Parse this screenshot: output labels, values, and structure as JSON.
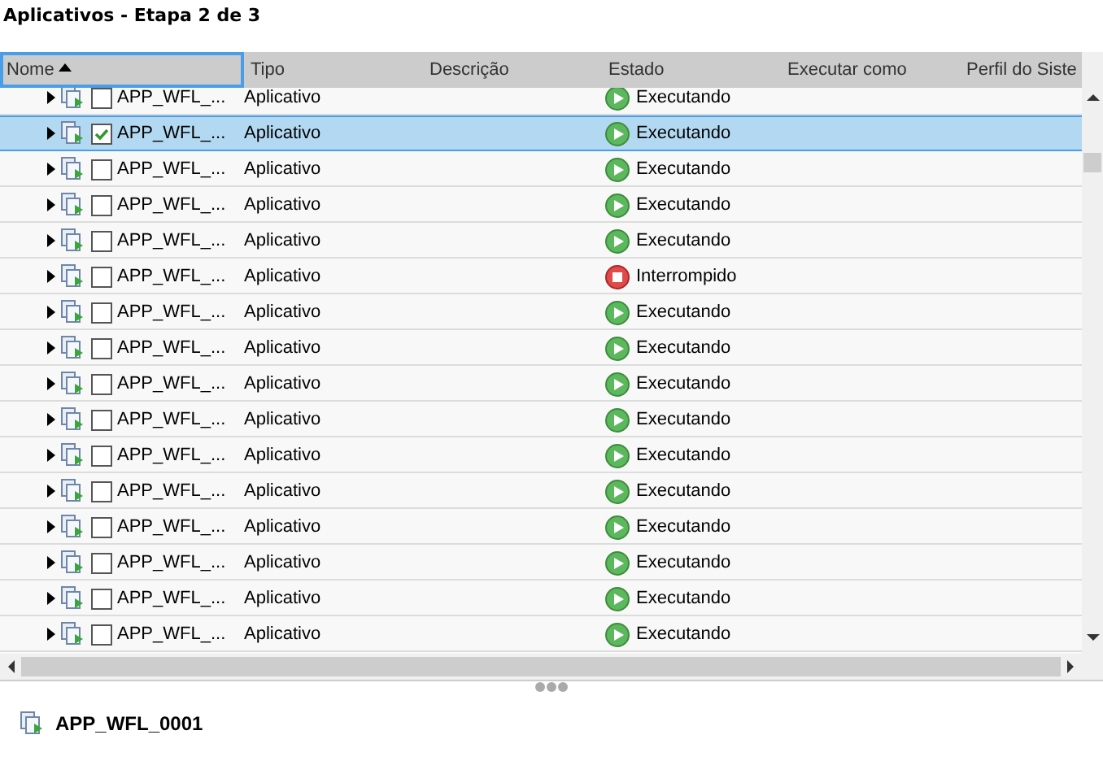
{
  "title": "Aplicativos - Etapa 2 de 3",
  "columns": [
    {
      "label": "Nome",
      "sorted": true,
      "focused": true
    },
    {
      "label": "Tipo",
      "sorted": false,
      "focused": false
    },
    {
      "label": "Descrição",
      "sorted": false,
      "focused": false
    },
    {
      "label": "Estado",
      "sorted": false,
      "focused": false
    },
    {
      "label": "Executar como",
      "sorted": false,
      "focused": false
    },
    {
      "label": "Perfil do Siste",
      "sorted": false,
      "focused": false
    }
  ],
  "rows": [
    {
      "name": "APP_WFL_...",
      "type": "Aplicativo",
      "status": "Executando",
      "kind": "running",
      "checked": false,
      "selected": false
    },
    {
      "name": "APP_WFL_...",
      "type": "Aplicativo",
      "status": "Executando",
      "kind": "running",
      "checked": true,
      "selected": true
    },
    {
      "name": "APP_WFL_...",
      "type": "Aplicativo",
      "status": "Executando",
      "kind": "running",
      "checked": false,
      "selected": false
    },
    {
      "name": "APP_WFL_...",
      "type": "Aplicativo",
      "status": "Executando",
      "kind": "running",
      "checked": false,
      "selected": false
    },
    {
      "name": "APP_WFL_...",
      "type": "Aplicativo",
      "status": "Executando",
      "kind": "running",
      "checked": false,
      "selected": false
    },
    {
      "name": "APP_WFL_...",
      "type": "Aplicativo",
      "status": "Interrompido",
      "kind": "stopped",
      "checked": false,
      "selected": false
    },
    {
      "name": "APP_WFL_...",
      "type": "Aplicativo",
      "status": "Executando",
      "kind": "running",
      "checked": false,
      "selected": false
    },
    {
      "name": "APP_WFL_...",
      "type": "Aplicativo",
      "status": "Executando",
      "kind": "running",
      "checked": false,
      "selected": false
    },
    {
      "name": "APP_WFL_...",
      "type": "Aplicativo",
      "status": "Executando",
      "kind": "running",
      "checked": false,
      "selected": false
    },
    {
      "name": "APP_WFL_...",
      "type": "Aplicativo",
      "status": "Executando",
      "kind": "running",
      "checked": false,
      "selected": false
    },
    {
      "name": "APP_WFL_...",
      "type": "Aplicativo",
      "status": "Executando",
      "kind": "running",
      "checked": false,
      "selected": false
    },
    {
      "name": "APP_WFL_...",
      "type": "Aplicativo",
      "status": "Executando",
      "kind": "running",
      "checked": false,
      "selected": false
    },
    {
      "name": "APP_WFL_...",
      "type": "Aplicativo",
      "status": "Executando",
      "kind": "running",
      "checked": false,
      "selected": false
    },
    {
      "name": "APP_WFL_...",
      "type": "Aplicativo",
      "status": "Executando",
      "kind": "running",
      "checked": false,
      "selected": false
    },
    {
      "name": "APP_WFL_...",
      "type": "Aplicativo",
      "status": "Executando",
      "kind": "running",
      "checked": false,
      "selected": false
    },
    {
      "name": "APP_WFL_...",
      "type": "Aplicativo",
      "status": "Executando",
      "kind": "running",
      "checked": false,
      "selected": false
    }
  ],
  "footer": {
    "name": "APP_WFL_0001"
  }
}
